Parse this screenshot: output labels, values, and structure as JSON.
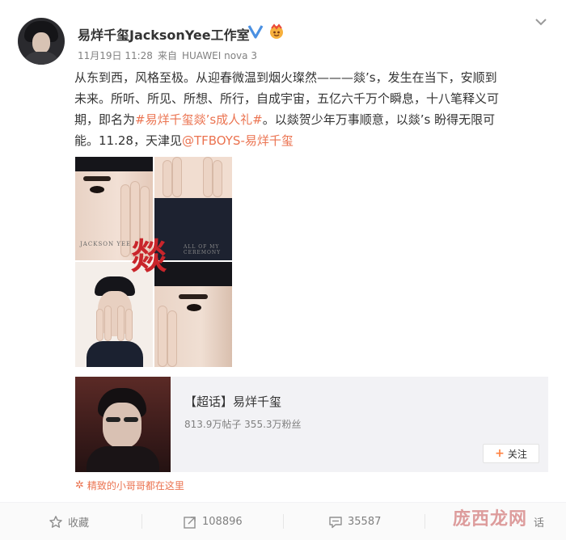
{
  "post": {
    "author": "易烊千玺JacksonYee工作室",
    "time": "11月19日 11:28",
    "source_prefix": "来自",
    "source": "HUAWEI nova 3",
    "text_lines": [
      "从东到西，风格至极。从迎春微温到烟火璨然———燚’s，发生在当下，安顺到",
      "未来。所听、所见、所想、所行，自成宇宙，五亿六千万个瞬息，十八笔释义可",
      "期，即名为",
      "能。11.28，天津见"
    ],
    "hashtag": "#易烊千玺燚’s成人礼#",
    "line3_after_hashtag": "。以燚贺少年万事顺意，以燚’s 盼得无限可",
    "mention": "@TFBOYS-易烊千玺",
    "poster_char": "燚",
    "poster_captions": {
      "left": "JACKSON YEE",
      "right": "ALL OF MY CEREMONY"
    }
  },
  "topic_card": {
    "title": "【超话】易烊千玺",
    "stats": "813.9万帖子 355.3万粉丝",
    "follow_label": "关注"
  },
  "tagline": "精致的小哥哥都在这里",
  "actions": {
    "favorite": "收藏",
    "repost": "108896",
    "comment": "35587",
    "like": "话"
  },
  "watermark": "庞西龙网",
  "colors": {
    "link": "#eb7350",
    "verified": "#4a90e2",
    "poster_red": "#c9252b"
  }
}
